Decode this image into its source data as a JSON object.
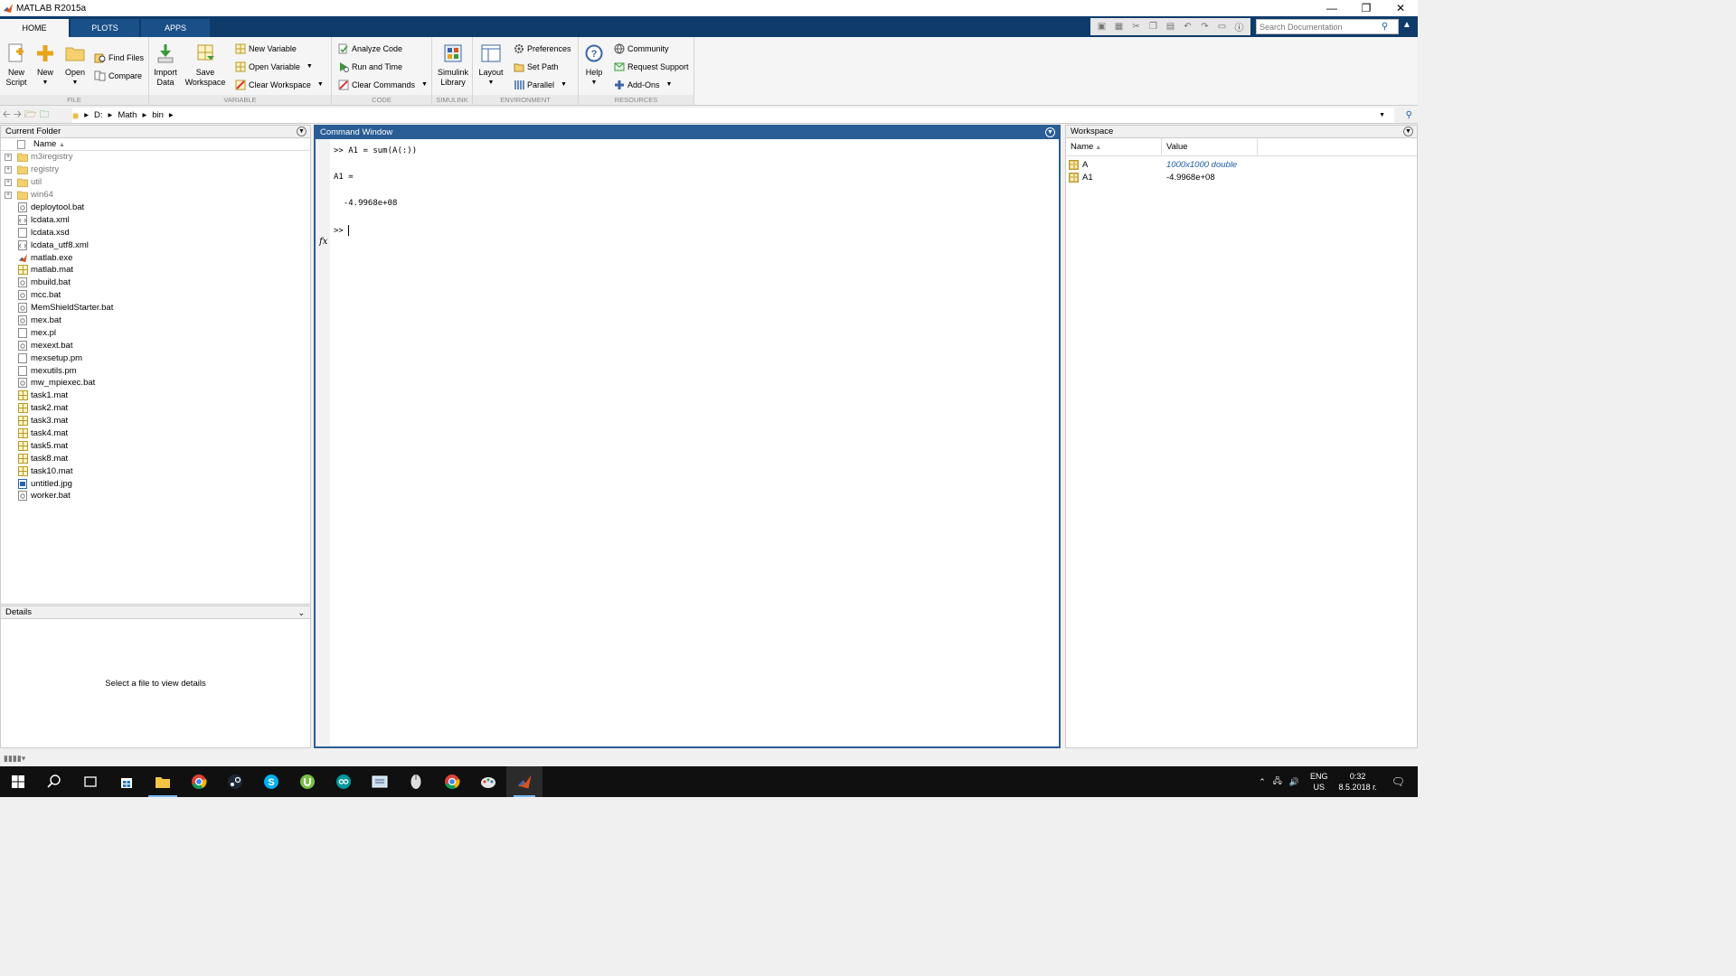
{
  "window": {
    "title": "MATLAB R2015a"
  },
  "ribbon_tabs": [
    "HOME",
    "PLOTS",
    "APPS"
  ],
  "search": {
    "placeholder": "Search Documentation"
  },
  "ribbon": {
    "file": {
      "label": "FILE",
      "new_script": "New Script",
      "new": "New",
      "open": "Open",
      "find_files": "Find Files",
      "compare": "Compare"
    },
    "variable": {
      "label": "VARIABLE",
      "import_data": "Import Data",
      "save_workspace": "Save Workspace",
      "new_variable": "New Variable",
      "open_variable": "Open Variable",
      "clear_workspace": "Clear Workspace"
    },
    "code": {
      "label": "CODE",
      "analyze_code": "Analyze Code",
      "run_and_time": "Run and Time",
      "clear_commands": "Clear Commands"
    },
    "simulink": {
      "label": "SIMULINK",
      "simulink_library": "Simulink Library"
    },
    "environment": {
      "label": "ENVIRONMENT",
      "layout": "Layout",
      "preferences": "Preferences",
      "set_path": "Set Path",
      "parallel": "Parallel"
    },
    "resources": {
      "label": "RESOURCES",
      "help": "Help",
      "community": "Community",
      "request_support": "Request Support",
      "add_ons": "Add-Ons"
    }
  },
  "address": {
    "segments": [
      "D:",
      "Math",
      "bin"
    ]
  },
  "current_folder": {
    "title": "Current Folder",
    "column": "Name",
    "items": [
      {
        "name": "m3iregistry",
        "type": "folder"
      },
      {
        "name": "registry",
        "type": "folder"
      },
      {
        "name": "util",
        "type": "folder"
      },
      {
        "name": "win64",
        "type": "folder"
      },
      {
        "name": "deploytool.bat",
        "type": "bat"
      },
      {
        "name": "lcdata.xml",
        "type": "xml"
      },
      {
        "name": "lcdata.xsd",
        "type": "file"
      },
      {
        "name": "lcdata_utf8.xml",
        "type": "xml"
      },
      {
        "name": "matlab.exe",
        "type": "exe"
      },
      {
        "name": "matlab.mat",
        "type": "mat"
      },
      {
        "name": "mbuild.bat",
        "type": "bat"
      },
      {
        "name": "mcc.bat",
        "type": "bat"
      },
      {
        "name": "MemShieldStarter.bat",
        "type": "bat"
      },
      {
        "name": "mex.bat",
        "type": "bat"
      },
      {
        "name": "mex.pl",
        "type": "file"
      },
      {
        "name": "mexext.bat",
        "type": "bat"
      },
      {
        "name": "mexsetup.pm",
        "type": "file"
      },
      {
        "name": "mexutils.pm",
        "type": "file"
      },
      {
        "name": "mw_mpiexec.bat",
        "type": "bat"
      },
      {
        "name": "task1.mat",
        "type": "mat"
      },
      {
        "name": "task2.mat",
        "type": "mat"
      },
      {
        "name": "task3.mat",
        "type": "mat"
      },
      {
        "name": "task4.mat",
        "type": "mat"
      },
      {
        "name": "task5.mat",
        "type": "mat"
      },
      {
        "name": "task8.mat",
        "type": "mat"
      },
      {
        "name": "task10.mat",
        "type": "mat"
      },
      {
        "name": "untitled.jpg",
        "type": "jpg"
      },
      {
        "name": "worker.bat",
        "type": "bat"
      }
    ]
  },
  "details": {
    "title": "Details",
    "message": "Select a file to view details"
  },
  "command_window": {
    "title": "Command Window",
    "lines": [
      ">> A1 = sum(A(:))",
      "A1 =",
      "  -4.9968e+08"
    ],
    "prompt": ">>"
  },
  "workspace": {
    "title": "Workspace",
    "columns": [
      "Name",
      "Value"
    ],
    "rows": [
      {
        "name": "A",
        "value": "1000x1000 double"
      },
      {
        "name": "A1",
        "value": "-4.9968e+08"
      }
    ]
  },
  "taskbar": {
    "lang": "ENG",
    "region": "US",
    "time": "0:32",
    "date": "8.5.2018 г."
  },
  "colors": {
    "accent": "#2a5d95",
    "tabstrip": "#0f3b6b",
    "taskbar": "#101010"
  }
}
